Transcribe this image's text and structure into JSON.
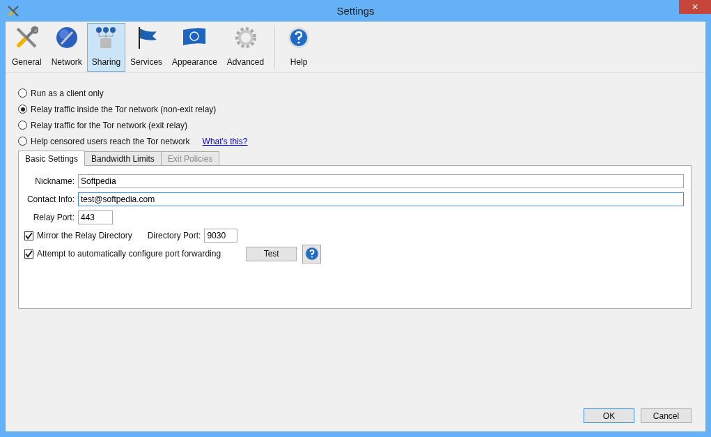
{
  "window": {
    "title": "Settings",
    "close": "✕"
  },
  "toolbar": [
    {
      "label": "General",
      "kind": "tools",
      "selected": false
    },
    {
      "label": "Network",
      "kind": "globe",
      "selected": false
    },
    {
      "label": "Sharing",
      "kind": "sharing",
      "selected": true
    },
    {
      "label": "Services",
      "kind": "flag",
      "selected": false
    },
    {
      "label": "Appearance",
      "kind": "banner",
      "selected": false
    },
    {
      "label": "Advanced",
      "kind": "gear",
      "selected": false
    },
    {
      "label": "Help",
      "kind": "help",
      "selected": false
    }
  ],
  "modes": [
    {
      "label": "Run as a client only",
      "selected": false
    },
    {
      "label": "Relay traffic inside the Tor network (non-exit relay)",
      "selected": true
    },
    {
      "label": "Relay traffic for the Tor network (exit relay)",
      "selected": false
    },
    {
      "label": "Help censored users reach the Tor network",
      "selected": false,
      "link": "What's this?"
    }
  ],
  "tabs": [
    {
      "label": "Basic Settings",
      "selected": true,
      "disabled": false
    },
    {
      "label": "Bandwidth Limits",
      "selected": false,
      "disabled": false
    },
    {
      "label": "Exit Policies",
      "selected": false,
      "disabled": true
    }
  ],
  "fields": [
    {
      "label": "Nickname:",
      "value": "Softpedia",
      "focused": false
    },
    {
      "label": "Contact Info:",
      "value": "test@softpedia.com",
      "focused": true
    }
  ],
  "relay_port": {
    "label": "Relay Port:",
    "value": "443"
  },
  "mirror": {
    "label": "Mirror the Relay Directory",
    "checked": true
  },
  "directory_port": {
    "label": "Directory Port:",
    "value": "9030"
  },
  "forwarding": {
    "label": "Attempt to automatically configure port forwarding",
    "checked": true
  },
  "test_button": "Test",
  "buttons": [
    {
      "label": "OK",
      "default": true
    },
    {
      "label": "Cancel",
      "default": false
    }
  ]
}
